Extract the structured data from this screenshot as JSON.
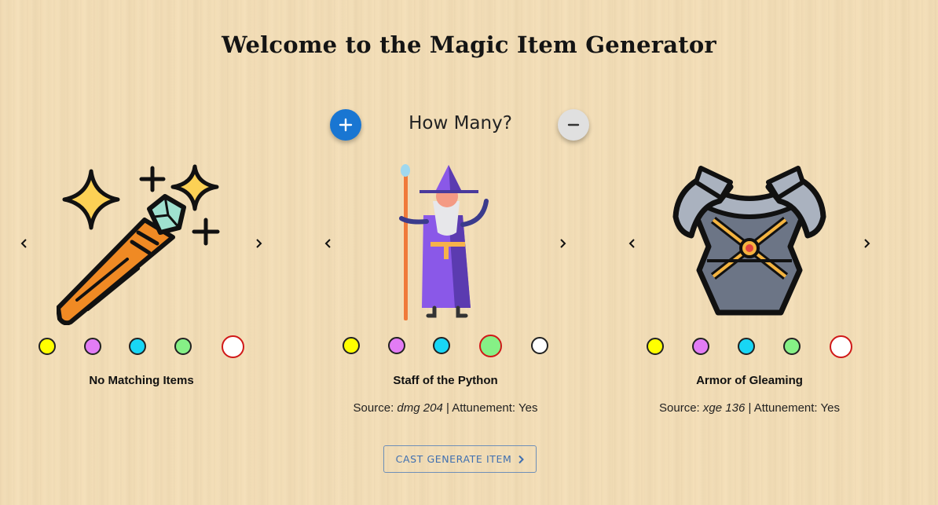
{
  "page": {
    "title": "Welcome to the Magic Item Generator"
  },
  "controls": {
    "how_many_label": "How Many?",
    "increase_icon": "plus-icon",
    "decrease_icon": "minus-icon"
  },
  "rarity_colors": [
    "#ffff00",
    "#e27cf5",
    "#18d6f5",
    "#86f086",
    "#ffffff"
  ],
  "items": [
    {
      "name": "No Matching Items",
      "image": "magic-wand-icon",
      "source_label": "",
      "source_book": "",
      "attunement_label": "",
      "selected_rarity": 4
    },
    {
      "name": "Staff of the Python",
      "image": "wizard-with-staff-icon",
      "source_label": "Source: ",
      "source_book": "dmg 204",
      "attunement_label": " | Attunement: Yes",
      "selected_rarity": 3
    },
    {
      "name": "Armor of Gleaming",
      "image": "plate-armor-icon",
      "source_label": "Source: ",
      "source_book": "xge 136",
      "attunement_label": " | Attunement: Yes",
      "selected_rarity": 4
    }
  ],
  "action": {
    "cast_label": "CAST GENERATE ITEM"
  }
}
